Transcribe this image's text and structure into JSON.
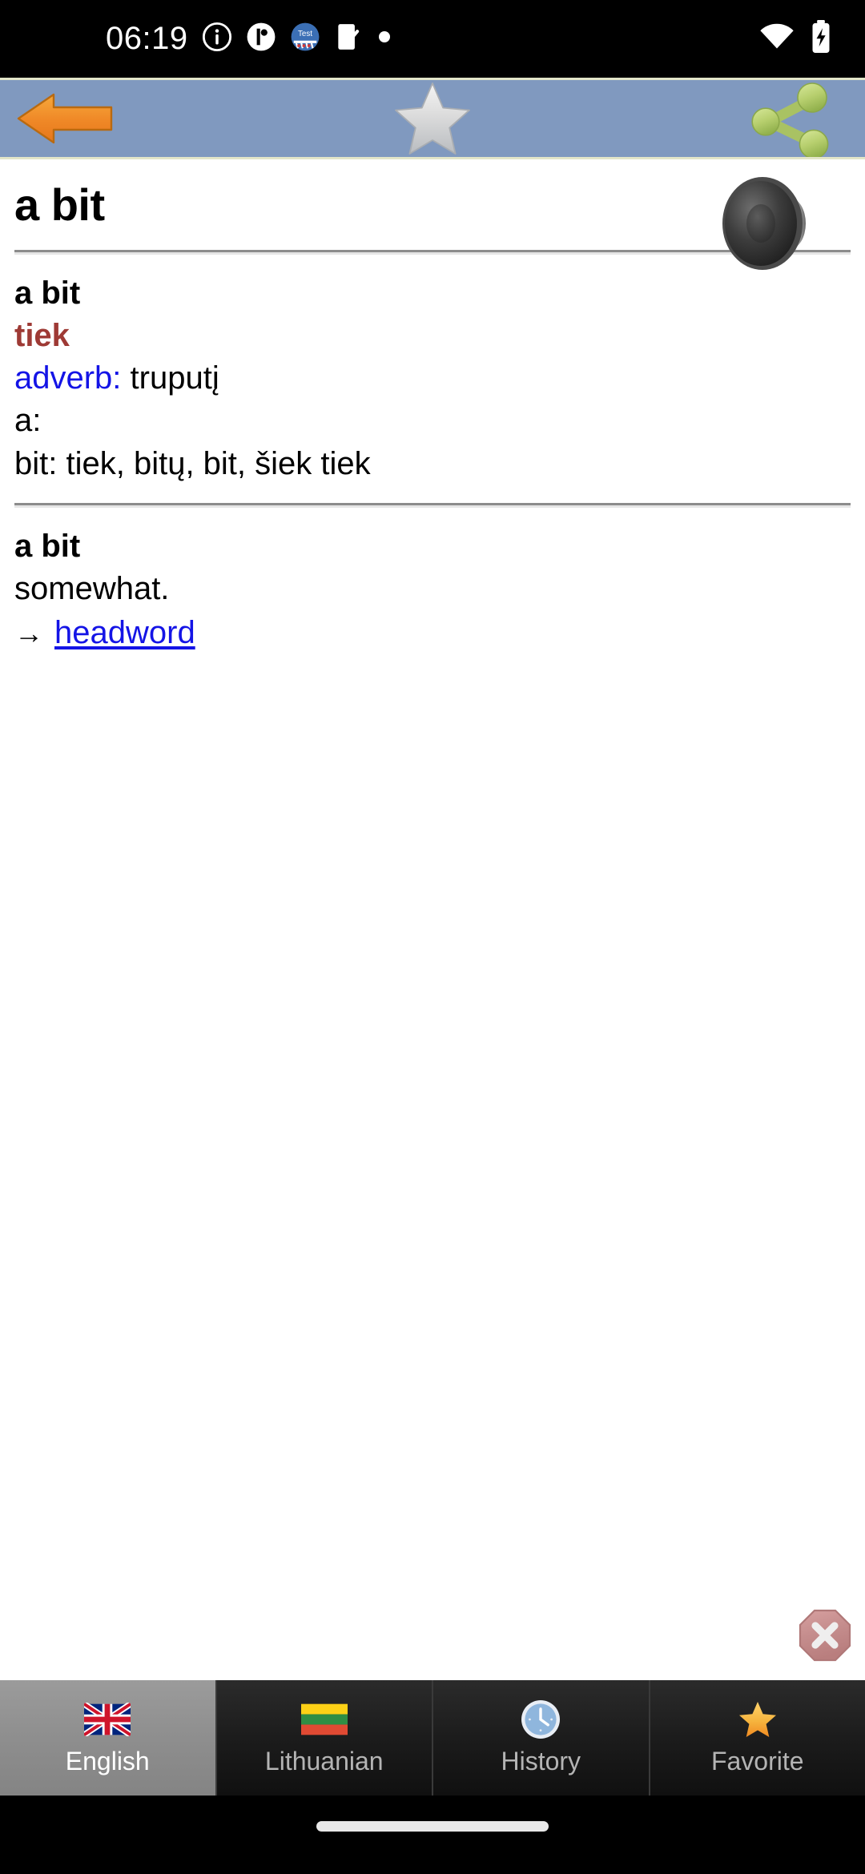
{
  "status_bar": {
    "time": "06:19",
    "left_icons": [
      "info-icon",
      "app-notification-icon",
      "test-app-icon",
      "checklist-icon",
      "dot-icon"
    ],
    "right_icons": [
      "wifi-icon",
      "battery-charging-icon"
    ]
  },
  "toolbar": {
    "back_label": "Back",
    "favorite_label": "Add to favorites",
    "share_label": "Share",
    "background_color": "#8099bf",
    "border_color": "#e2e5c8"
  },
  "article": {
    "headword": "a bit",
    "speaker_label": "Pronounce",
    "entry_one": {
      "term": "a bit",
      "translation": "tiek",
      "translation_color": "#9e3a35",
      "pos": "adverb:",
      "pos_color": "#1414e6",
      "pos_gloss": "truputį",
      "sub_label": "a:",
      "forms": "bit: tiek, bitų, bit, šiek tiek"
    },
    "entry_two": {
      "term": "a bit",
      "definition": "somewhat.",
      "xref_arrow": "→",
      "xref_link": "headword"
    }
  },
  "close_button": {
    "label": "Close",
    "icon": "close-octagon-icon",
    "color": "#c98c8c"
  },
  "tabs": [
    {
      "label": "English",
      "icon": "uk-flag-icon",
      "active": true
    },
    {
      "label": "Lithuanian",
      "icon": "lithuania-flag-icon",
      "active": false
    },
    {
      "label": "History",
      "icon": "clock-icon",
      "active": false
    },
    {
      "label": "Favorite",
      "icon": "star-icon",
      "active": false
    }
  ],
  "navigation_bar": {
    "gesture_handle": "home-gesture-bar"
  }
}
